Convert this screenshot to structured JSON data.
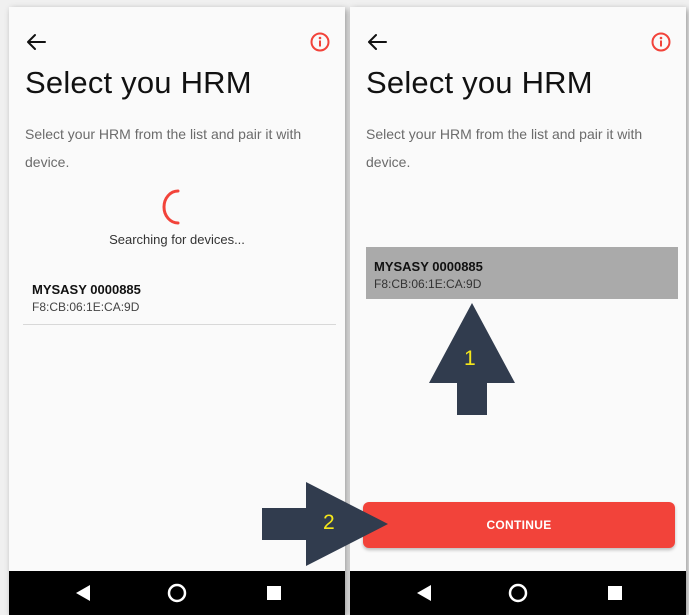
{
  "left_screen": {
    "title": "Select you HRM",
    "subtitle": "Select your HRM from the list and pair it with device.",
    "searching_text": "Searching for devices...",
    "device": {
      "name": "MYSASY 0000885",
      "mac": "F8:CB:06:1E:CA:9D"
    }
  },
  "right_screen": {
    "title": "Select you HRM",
    "subtitle": "Select your HRM from the list and pair it with device.",
    "device": {
      "name": "MYSASY 0000885",
      "mac": "F8:CB:06:1E:CA:9D",
      "selected": true
    },
    "continue_label": "CONTINUE"
  },
  "annotations": {
    "step1": "1",
    "step2": "2"
  },
  "colors": {
    "accent": "#f2433a",
    "arrow": "#313c4e",
    "annotation_text": "#f5e71a",
    "selected_row": "#aaaaaa"
  },
  "icons": {
    "back": "arrow-left-icon",
    "info": "info-circle-icon",
    "spinner": "loading-spinner-icon",
    "nav_back": "triangle-back-icon",
    "nav_home": "circle-home-icon",
    "nav_recent": "square-recent-icon"
  }
}
